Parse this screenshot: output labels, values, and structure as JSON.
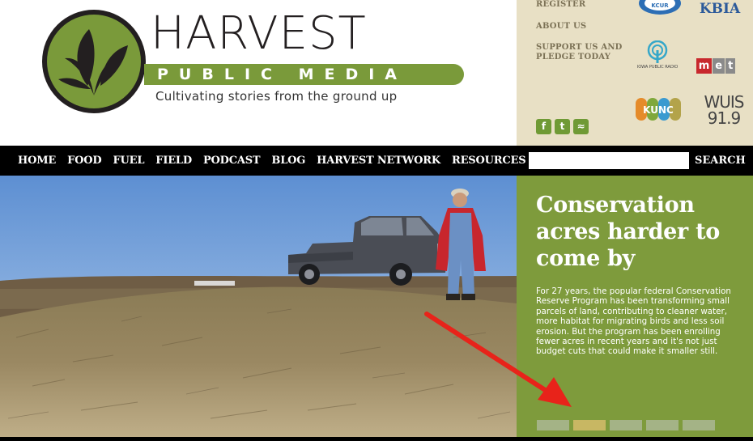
{
  "brand": {
    "title": "HARVEST",
    "subtitle": "PUBLIC MEDIA",
    "tagline": "Cultivating stories from the ground up"
  },
  "utility_links": [
    "REGISTER",
    "ABOUT US",
    "SUPPORT US AND PLEDGE TODAY"
  ],
  "social": [
    {
      "icon": "facebook-icon",
      "glyph": "f"
    },
    {
      "icon": "twitter-icon",
      "glyph": "t"
    },
    {
      "icon": "rss-icon",
      "glyph": "≈"
    }
  ],
  "partners": {
    "kcur": "KCUR",
    "kbia": "KBIA",
    "iowa": "IOWA PUBLIC RADIO",
    "met": [
      "m",
      "e",
      "t"
    ],
    "kunc": "KUNC",
    "wuis": "WUIS",
    "wuis_freq": "91.9"
  },
  "nav": {
    "items": [
      "HOME",
      "FOOD",
      "FUEL",
      "FIELD",
      "PODCAST",
      "BLOG",
      "HARVEST NETWORK",
      "RESOURCES"
    ],
    "search_value": "",
    "search_button": "SEARCH"
  },
  "feature": {
    "title": "Conservation acres harder to come by",
    "text": "For 27 years, the popular federal Conservation Reserve Program has been transforming small parcels of land, contributing to cleaner water, more habitat for migrating birds and less soil erosion. But the program has been enrolling fewer acres in recent years and it's not just budget cuts that could make it smaller still.",
    "slides": 5,
    "active_slide": 2
  },
  "colors": {
    "accent_green": "#7e9b3c",
    "panel_beige": "#e8e0c5",
    "active_dot": "#c8b763",
    "arrow": "#e8231a"
  }
}
